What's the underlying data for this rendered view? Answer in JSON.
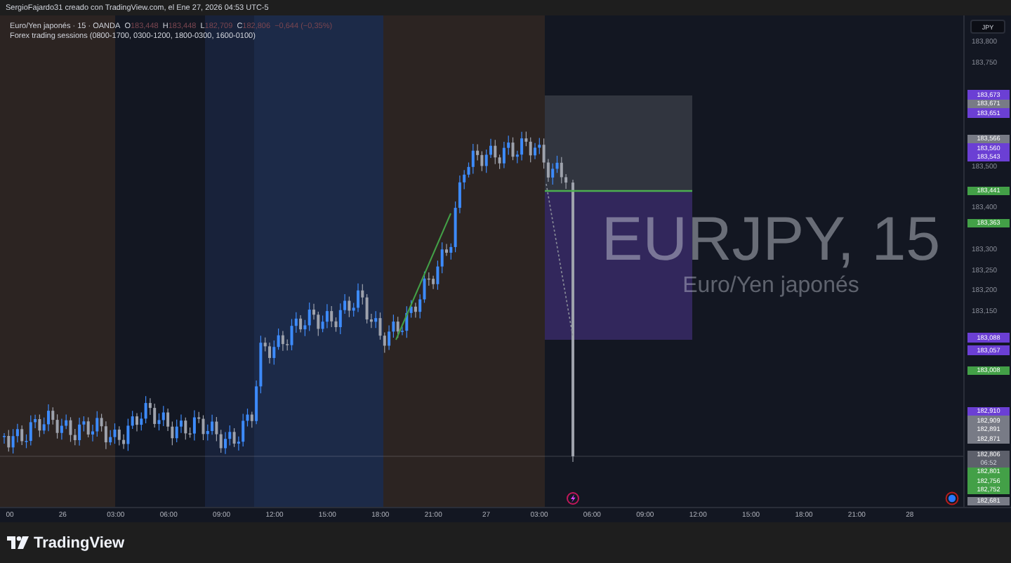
{
  "header": {
    "text": "SergioFajardo31 creado con TradingView.com, el Ene 27, 2026 04:53 UTC-5"
  },
  "legend": {
    "symbol": "Euro/Yen japonés · 15 · OANDA",
    "ohlc": [
      {
        "label": "O",
        "value": "183,448"
      },
      {
        "label": "H",
        "value": "183,448"
      },
      {
        "label": "L",
        "value": "182,709"
      },
      {
        "label": "C",
        "value": "182,806"
      }
    ],
    "change": "−0,644 (−0,35%)",
    "indicator": "Forex trading sessions (0800-1700, 0300-1200, 1800-0300, 1600-0100)"
  },
  "watermark": {
    "symbol": "EURJPY, 15",
    "description": "Euro/Yen japonés"
  },
  "price_axis": {
    "currency": "JPY",
    "ticks": [
      "183,800",
      "183,750",
      "183,500",
      "183,400",
      "183,300",
      "183,250",
      "183,200",
      "183,150"
    ],
    "tags": [
      {
        "text": "183,673",
        "color": "#6b3fd4"
      },
      {
        "text": "183,671",
        "color": "#787b86"
      },
      {
        "text": "183,651",
        "color": "#6b3fd4"
      },
      {
        "text": "183,566",
        "color": "#787b86"
      },
      {
        "text": "183,560",
        "color": "#6b3fd4"
      },
      {
        "text": "183,543",
        "color": "#6b3fd4"
      },
      {
        "text": "183,441",
        "color": "#43a047"
      },
      {
        "text": "183,363",
        "color": "#43a047"
      },
      {
        "text": "183,088",
        "color": "#6b3fd4"
      },
      {
        "text": "183,057",
        "color": "#6b3fd4"
      },
      {
        "text": "183,008",
        "color": "#43a047"
      },
      {
        "text": "182,910",
        "color": "#6b3fd4"
      },
      {
        "text": "182,909",
        "color": "#787b86"
      },
      {
        "text": "182,891",
        "color": "#787b86"
      },
      {
        "text": "182,871",
        "color": "#787b86"
      },
      {
        "text": "182,806",
        "color": "#5d606b",
        "countdown": "06:52"
      },
      {
        "text": "182,801",
        "color": "#43a047"
      },
      {
        "text": "182,756",
        "color": "#43a047"
      },
      {
        "text": "182,752",
        "color": "#43a047"
      },
      {
        "text": "182,681",
        "color": "#787b86"
      }
    ]
  },
  "time_axis": {
    "labels": [
      "00",
      "26",
      "03:00",
      "06:00",
      "09:00",
      "12:00",
      "15:00",
      "18:00",
      "21:00",
      "27",
      "03:00",
      "06:00",
      "09:00",
      "12:00",
      "15:00",
      "18:00",
      "21:00",
      "28"
    ]
  },
  "footer": {
    "logo": "TradingView"
  }
}
